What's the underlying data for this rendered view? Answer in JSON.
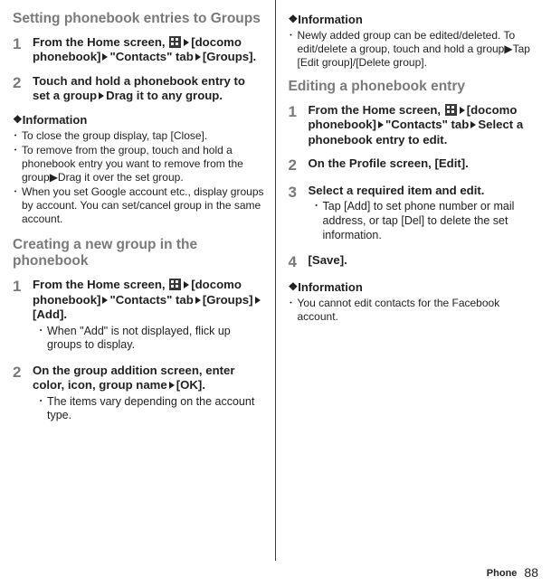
{
  "left": {
    "sec1_heading": "Setting phonebook entries to Groups",
    "sec1_steps": [
      {
        "num": "1",
        "text_a": "From the Home screen, ",
        "text_b": "[docomo phonebook]",
        "text_c": "\"Contacts\" tab",
        "text_d": "[Groups]."
      },
      {
        "num": "2",
        "text_a": "Touch and hold a phonebook entry to set a group",
        "text_b": "Drag it to any group."
      }
    ],
    "info_head": "Information",
    "sec1_info": [
      "To close the group display, tap [Close].",
      "To remove from the group, touch and hold a phonebook entry you want to remove from the group▶Drag it over the set group.",
      "When you set Google account etc., display groups by account. You can set/cancel group in the same account."
    ],
    "sec2_heading": "Creating a new group in the phonebook",
    "sec2_steps": [
      {
        "num": "1",
        "text_a": "From the Home screen, ",
        "text_b": "[docomo phonebook]",
        "text_c": "\"Contacts\" tab",
        "text_d": "[Groups]",
        "text_e": "[Add].",
        "note": "When \"Add\" is not displayed, flick up groups to display."
      },
      {
        "num": "2",
        "text_a": "On the group addition screen, enter color, icon, group name",
        "text_b": "[OK].",
        "note": "The items vary depending on the account type."
      }
    ]
  },
  "right": {
    "info_head": "Information",
    "top_info": [
      "Newly added group can be edited/deleted. To edit/delete a group, touch and hold a group▶Tap [Edit group]/[Delete group]."
    ],
    "sec_heading": "Editing a phonebook entry",
    "steps": [
      {
        "num": "1",
        "text_a": "From the Home screen, ",
        "text_b": "[docomo phonebook]",
        "text_c": "\"Contacts\" tab",
        "text_d": "Select a phonebook entry to edit."
      },
      {
        "num": "2",
        "text_a": "On the Profile screen, [Edit]."
      },
      {
        "num": "3",
        "text_a": "Select a required item and edit.",
        "note": "Tap [Add] to set phone number or mail address, or tap [Del] to delete the set information."
      },
      {
        "num": "4",
        "text_a": "[Save]."
      }
    ],
    "info2_head": "Information",
    "info2": [
      "You cannot edit contacts for the Facebook account."
    ]
  },
  "footer_label": "Phone",
  "footer_page": "88"
}
